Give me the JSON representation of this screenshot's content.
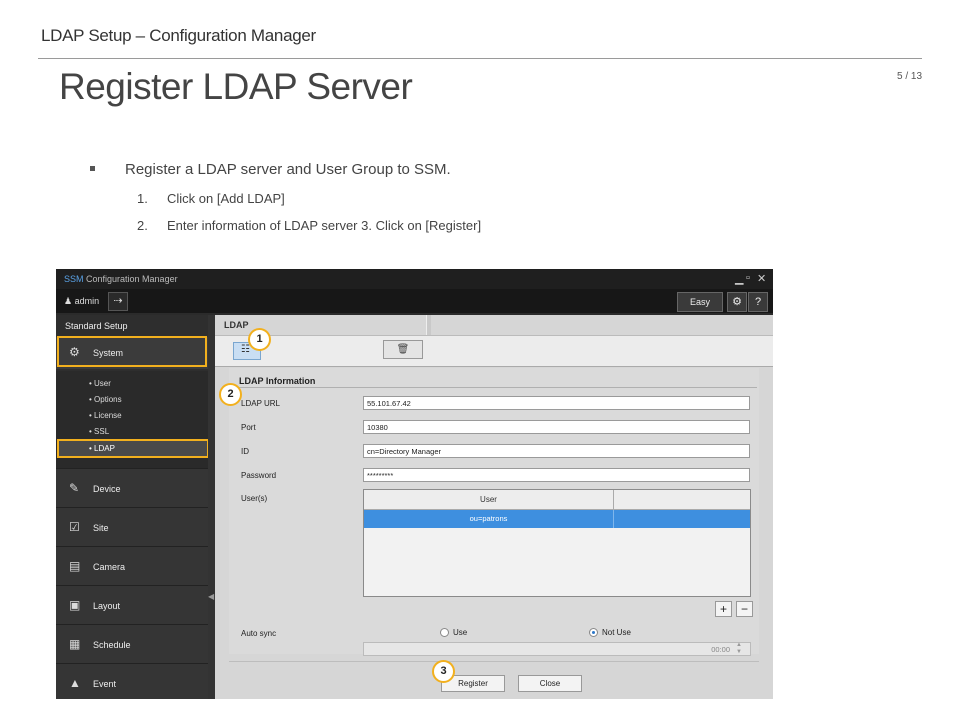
{
  "slide": {
    "header": "LDAP Setup – Configuration Manager",
    "title": "Register LDAP Server",
    "page_number": "5 / 13",
    "bullet": "Register a LDAP server and User Group to SSM.",
    "steps": [
      {
        "num": "1.",
        "text": "Click on [Add LDAP]"
      },
      {
        "num": "2.",
        "text": "Enter information  of LDAP server 3. Click on [Register]"
      }
    ]
  },
  "app": {
    "title_brand": "SSM",
    "title_rest": " Configuration Manager",
    "window_controls": {
      "minimize": "▁",
      "maximize": "▫",
      "close": "✕"
    },
    "user": "admin",
    "easy_guide": "Easy Guide",
    "settings_icon": "gear-icon",
    "help": "?"
  },
  "sidebar": {
    "section": "Standard Setup",
    "system": "System",
    "sub_items": [
      "User",
      "Options",
      "License",
      "SSL",
      "LDAP"
    ],
    "categories": [
      "Device",
      "Site",
      "Camera",
      "Layout",
      "Schedule",
      "Event"
    ]
  },
  "main": {
    "tab": "LDAP",
    "section_title": "LDAP Information",
    "fields": [
      {
        "label": "LDAP URL",
        "value": "55.101.67.42"
      },
      {
        "label": "Port",
        "value": "10380"
      },
      {
        "label": "ID",
        "value": "cn=Directory Manager"
      },
      {
        "label": "Password",
        "value": "*********"
      }
    ],
    "users_label": "User(s)",
    "users_header": "User",
    "users_rows": [
      "ou=patrons"
    ],
    "plus": "+",
    "minus": "−",
    "auto_sync_label": "Auto sync",
    "radio_use": "Use",
    "radio_not_use": "Not Use",
    "auto_sync_selected": "Not Use",
    "time": "00:00",
    "register": "Register",
    "close": "Close"
  },
  "callouts": [
    "1",
    "2",
    "3"
  ],
  "colors": {
    "highlight": "#f2b01e",
    "selection": "#3e8fdf",
    "brand": "#5aa2e6"
  }
}
